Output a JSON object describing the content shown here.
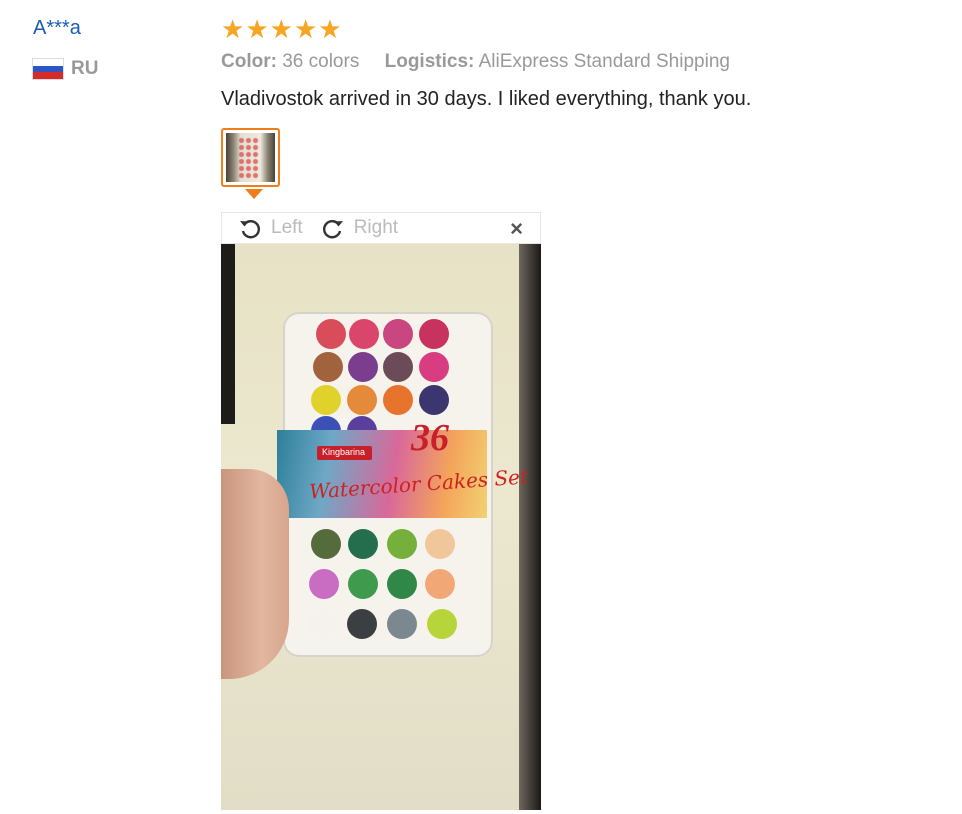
{
  "user": {
    "name": "A***a",
    "country_code": "RU"
  },
  "rating": {
    "stars": 5,
    "max": 5,
    "star_color": "#f6a623"
  },
  "attributes": {
    "color_label": "Color:",
    "color_value": "36 colors",
    "logistics_label": "Logistics:",
    "logistics_value": "AliExpress Standard Shipping"
  },
  "review_text": "Vladivostok arrived in 30 days. I liked everything, thank you.",
  "viewer": {
    "rotate_left_label": "Left",
    "rotate_right_label": "Right",
    "close_symbol": "×",
    "photo_print": {
      "count": "36",
      "brand": "Kingbarina",
      "product": "Watercolor Cakes Set"
    }
  },
  "colors": {
    "accent": "#f07c1a",
    "link": "#1a5db3",
    "muted_text": "#999999",
    "body_text": "#222222"
  },
  "icons": [
    "rotate-left-icon",
    "rotate-right-icon",
    "close-icon",
    "star-icon",
    "russia-flag-icon"
  ]
}
